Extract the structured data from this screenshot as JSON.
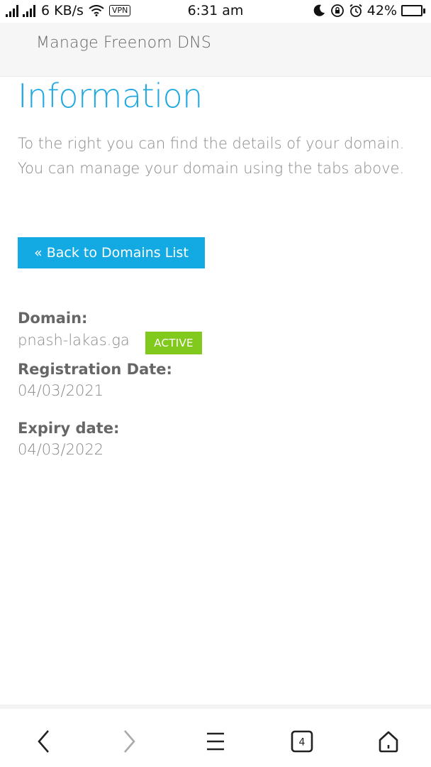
{
  "status_bar": {
    "network_speed": "6 KB/s",
    "vpn_label": "VPN",
    "time": "6:31 am",
    "battery_percent": "42%",
    "battery_level": 0.42
  },
  "header": {
    "title": "Manage Freenom DNS"
  },
  "main": {
    "heading": "Information",
    "intro": "To the right you can find the details of your domain. You can manage your domain using the tabs above.",
    "back_button_label": "« Back to Domains List",
    "domain_label": "Domain:",
    "domain_value": "pnash-lakas.ga",
    "status_badge": "ACTIVE",
    "registration_label": "Registration Date:",
    "registration_value": "04/03/2021",
    "expiry_label": "Expiry date:",
    "expiry_value": "04/03/2022"
  },
  "bottom_nav": {
    "tab_count": "4",
    "icons": [
      "back-icon",
      "forward-icon",
      "menu-icon",
      "tabs-icon",
      "home-icon"
    ]
  },
  "colors": {
    "accent": "#13a9e3",
    "heading": "#21a9e1",
    "active_badge": "#82c91e"
  }
}
